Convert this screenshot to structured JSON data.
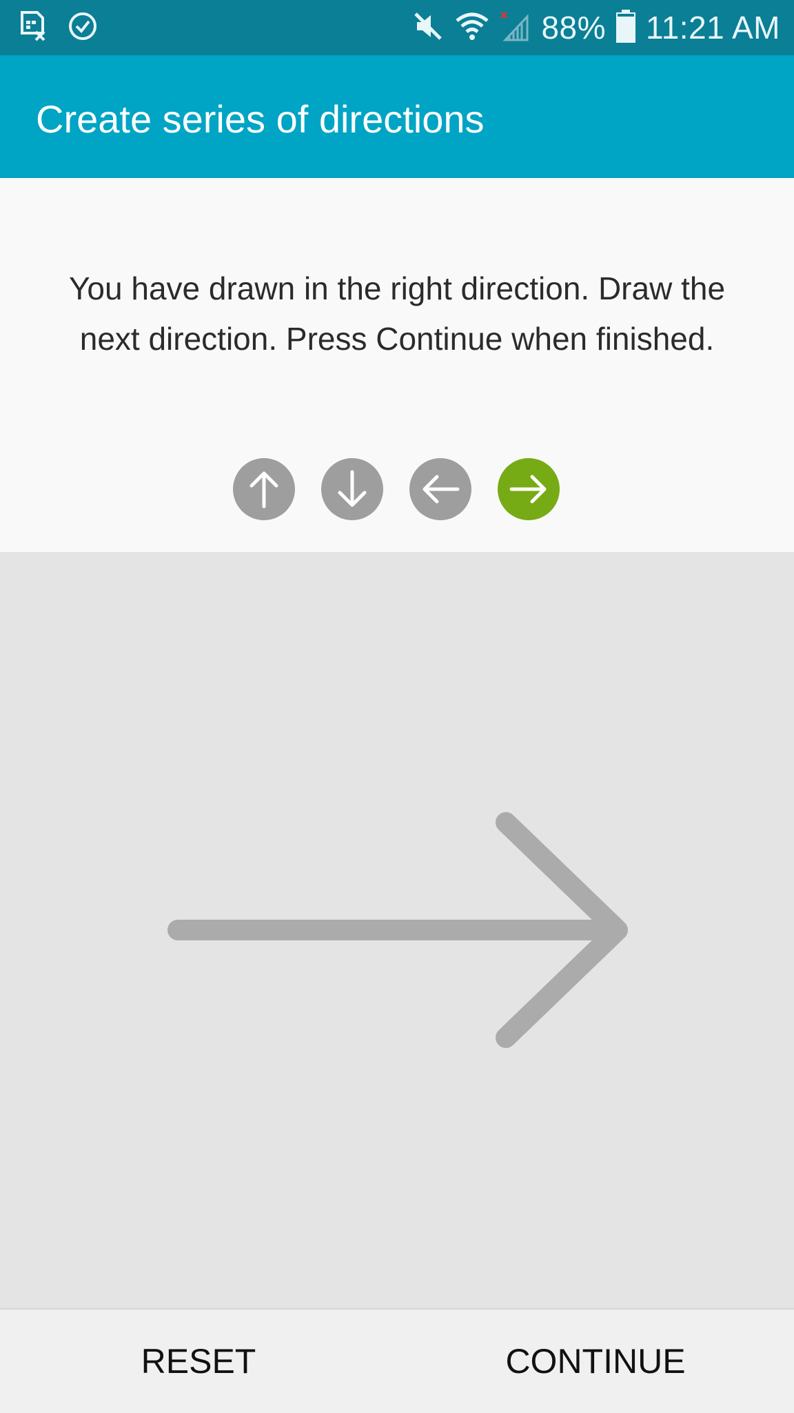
{
  "status_bar": {
    "battery_percent": "88%",
    "battery_level": 0.88,
    "time": "11:21 AM",
    "icons": [
      "sim-card-off-icon",
      "check-circle-icon",
      "mute-icon",
      "wifi-icon",
      "signal-no-service-icon",
      "battery-icon"
    ]
  },
  "app_bar": {
    "title": "Create series of directions"
  },
  "instruction": {
    "text": "You have drawn in the right direction. Draw the next direction. Press Continue when finished."
  },
  "directions": [
    {
      "name": "up",
      "icon": "arrow-up-icon",
      "state": "entered"
    },
    {
      "name": "down",
      "icon": "arrow-down-icon",
      "state": "entered"
    },
    {
      "name": "left",
      "icon": "arrow-left-icon",
      "state": "entered"
    },
    {
      "name": "right",
      "icon": "arrow-right-icon",
      "state": "current"
    }
  ],
  "drawn_direction": "right",
  "colors": {
    "status_bar": "#0a7f96",
    "app_bar": "#00a4c4",
    "direction_inactive": "#9e9e9e",
    "direction_active": "#76ab15",
    "drawn_arrow": "#ababab"
  },
  "buttons": {
    "reset_label": "RESET",
    "continue_label": "CONTINUE"
  }
}
